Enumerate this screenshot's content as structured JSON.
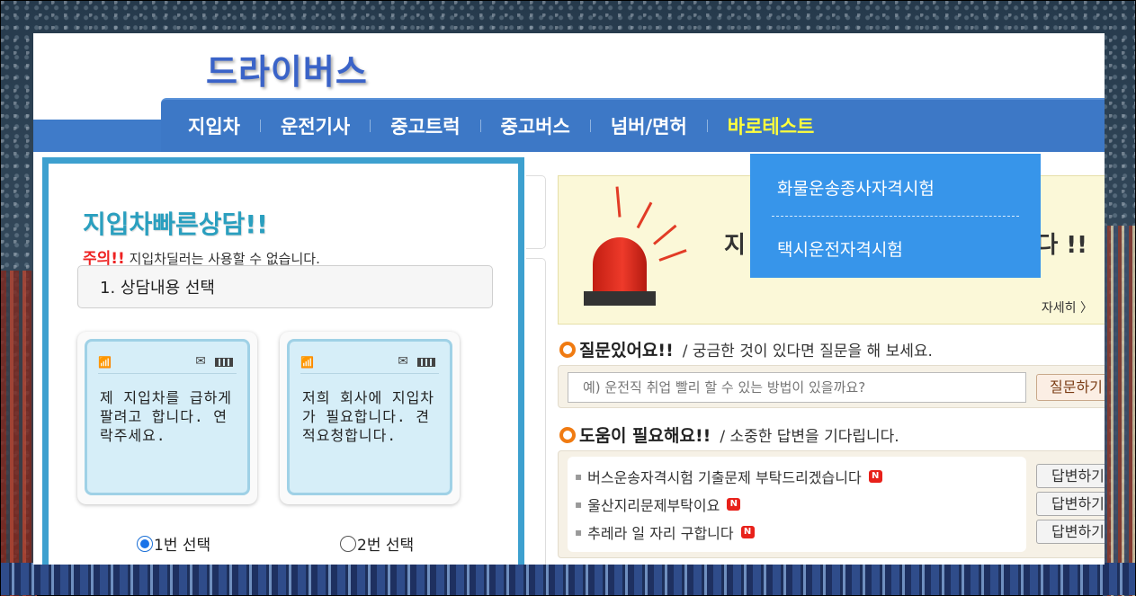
{
  "logo": {
    "text": "드라이버스"
  },
  "nav": {
    "items": [
      {
        "label": "지입차"
      },
      {
        "label": "운전기사"
      },
      {
        "label": "중고트럭"
      },
      {
        "label": "중고버스"
      },
      {
        "label": "넘버/면허"
      },
      {
        "label": "바로테스트"
      }
    ],
    "active_color": "#ffff3c",
    "dropdown": {
      "items": [
        {
          "label": "화물운송종사자격시험"
        },
        {
          "label": "택시운전자격시험"
        }
      ]
    }
  },
  "consult": {
    "title": "지입차빠른상담!!",
    "warn_prefix": "주의!!",
    "warn_text": " 지입차딜러는 사용할 수 없습니다.",
    "step_label": "1. 상담내용 선택",
    "cards": [
      {
        "text": "제 지입차를 급하게 팔려고 합니다. 연락주세요."
      },
      {
        "text": "저희 회사에 지입차가 필요합니다. 견적요청합니다."
      }
    ],
    "radios": [
      {
        "label": "1번 선택",
        "checked": true
      },
      {
        "label": "2번 선택",
        "checked": false
      }
    ]
  },
  "alert": {
    "text_left": "지",
    "text_right": "다 !!",
    "more": "자세히 〉"
  },
  "question": {
    "title": "질문있어요!!",
    "subtitle": "/ 궁금한 것이 있다면 질문을 해 보세요.",
    "placeholder": "예) 운전직 취업 빨리 할 수 있는 방법이 있을까요?",
    "button": "질문하기"
  },
  "help": {
    "title": "도움이 필요해요!!",
    "subtitle": "/ 소중한 답변을 기다립니다.",
    "items": [
      {
        "text": "버스운송자격시험 기출문제 부탁드리겠습니다",
        "badge": "N"
      },
      {
        "text": "울산지리문제부탁이요",
        "badge": "N"
      },
      {
        "text": "추레라 일 자리 구합니다",
        "badge": "N"
      }
    ],
    "answer_button": "답변하기"
  },
  "colors": {
    "nav_bg": "#3d78c6",
    "dropdown_bg": "#3795ea",
    "consult_border": "#3da0cf",
    "accent_orange": "#f07b12"
  }
}
